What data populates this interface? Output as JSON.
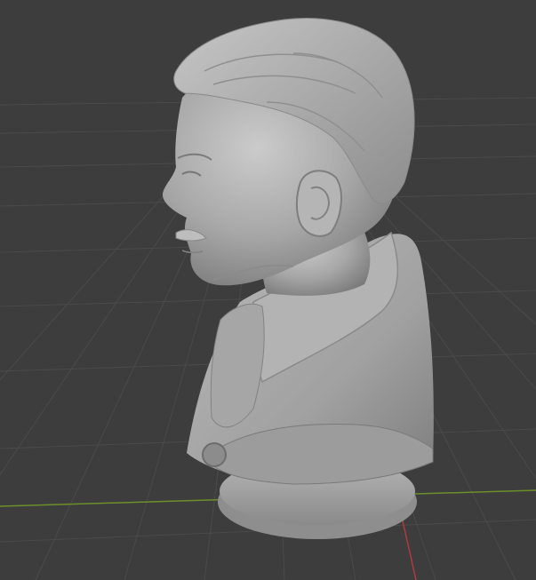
{
  "viewport": {
    "background_color": "#3d3d3d",
    "grid_color": "#4a4a4a",
    "x_axis_color": "#6d8f2a",
    "y_axis_color": "#b13a3f"
  },
  "model": {
    "label": "bust-sculpture",
    "surface_color": "#a9a9a9",
    "shadow_color": "#6f6f6f",
    "highlight_color": "#cfcfcf"
  }
}
